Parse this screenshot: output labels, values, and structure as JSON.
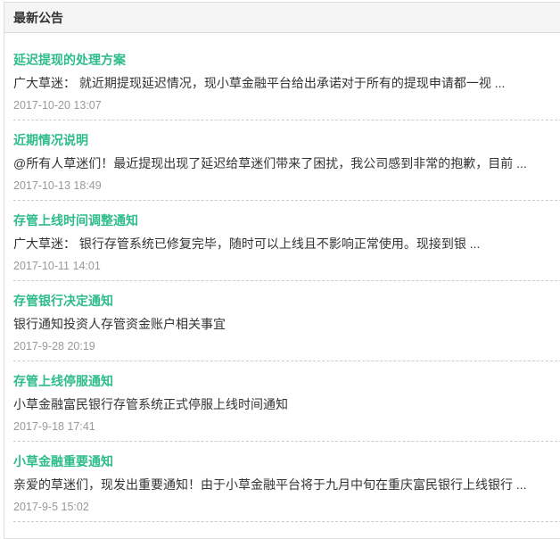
{
  "header": {
    "title": "最新公告"
  },
  "colors": {
    "accent": "#2ebd8a",
    "header_bg": "#f5f5f5"
  },
  "items": [
    {
      "title": "延迟提现的处理方案",
      "body": "广大草迷：  就近期提现延迟情况，现小草金融平台给出承诺对于所有的提现申请都一视 ...",
      "date": "2017-10-20 13:07"
    },
    {
      "title": "近期情况说明",
      "body": "@所有人草迷们！最近提现出现了延迟给草迷们带来了困扰，我公司感到非常的抱歉，目前 ...",
      "date": "2017-10-13 18:49"
    },
    {
      "title": "存管上线时间调整通知",
      "body": "广大草迷：  银行存管系统已修复完毕，随时可以上线且不影响正常使用。现接到银 ...",
      "date": "2017-10-11 14:01"
    },
    {
      "title": "存管银行决定通知",
      "body": "银行通知投资人存管资金账户相关事宜",
      "date": "2017-9-28 20:19"
    },
    {
      "title": "存管上线停服通知",
      "body": "小草金融富民银行存管系统正式停服上线时间通知",
      "date": "2017-9-18 17:41"
    },
    {
      "title": "小草金融重要通知",
      "body": "亲爱的草迷们，现发出重要通知！由于小草金融平台将于九月中旬在重庆富民银行上线银行 ...",
      "date": "2017-9-5 15:02"
    }
  ]
}
